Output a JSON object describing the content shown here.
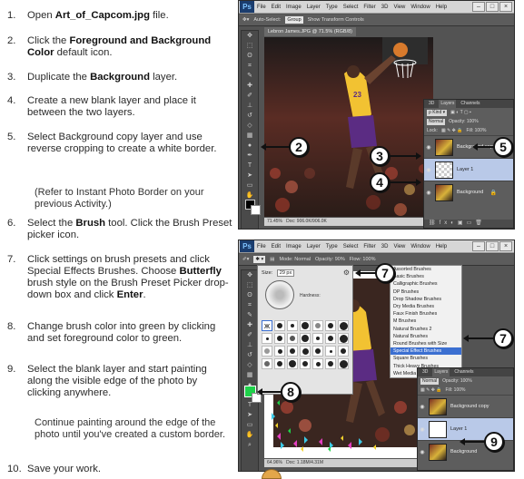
{
  "steps": [
    {
      "num": "1.",
      "parts": [
        {
          "t": "Open "
        },
        {
          "t": "Art_of_Capcom.jpg",
          "b": true
        },
        {
          "t": " file."
        }
      ]
    },
    {
      "num": "2.",
      "parts": [
        {
          "t": "Click the "
        },
        {
          "t": "Foreground and Background Color",
          "b": true
        },
        {
          "t": " default icon."
        }
      ]
    },
    {
      "num": "3.",
      "parts": [
        {
          "t": "Duplicate the "
        },
        {
          "t": "Background",
          "b": true
        },
        {
          "t": " layer."
        }
      ]
    },
    {
      "num": "4.",
      "parts": [
        {
          "t": "Create a new blank layer and place it between the two layers."
        }
      ]
    },
    {
      "num": "5.",
      "parts": [
        {
          "t": "Select Background copy layer and use reverse cropping to create a white border."
        }
      ]
    },
    {
      "num": "6.",
      "parts": [
        {
          "t": "Select the "
        },
        {
          "t": "Brush",
          "b": true
        },
        {
          "t": " tool. Click the Brush Preset picker icon."
        }
      ]
    },
    {
      "num": "7.",
      "parts": [
        {
          "t": "Click settings on brush presets and click Special Effects Brushes. Choose "
        },
        {
          "t": "Butterfly",
          "b": true
        },
        {
          "t": " brush style on the Brush Preset Picker drop-down box and click "
        },
        {
          "t": "Enter",
          "b": true
        },
        {
          "t": "."
        }
      ]
    },
    {
      "num": "8.",
      "parts": [
        {
          "t": "Change brush color into green by clicking and set foreground color to green."
        }
      ]
    },
    {
      "num": "9.",
      "parts": [
        {
          "t": "Select the blank layer and start painting along the visible edge of the photo by clicking anywhere."
        }
      ]
    },
    {
      "num": "10.",
      "parts": [
        {
          "t": "Save your work."
        }
      ]
    }
  ],
  "notes": {
    "after5": "(Refer to Instant Photo Border on your previous Activity.)",
    "after9": "Continue painting around the edge of the photo until you've created a custom border."
  },
  "ps_top": {
    "logo": "Ps",
    "menus": [
      "File",
      "Edit",
      "Image",
      "Layer",
      "Type",
      "Select",
      "Filter",
      "3D",
      "View",
      "Window",
      "Help"
    ],
    "options": [
      "Auto-Select:",
      "Group",
      "Show Transform Controls"
    ],
    "doc_tab": "Lebron James.JPG @ 71.5% (RGB/8)",
    "zoom": "71.45%",
    "doc_size": "Doc: 906.0K/906.0K",
    "timeline": "Timeline",
    "panel_tabs": [
      "3D",
      "Layers",
      "Channels"
    ],
    "blend": "Normal",
    "opacity": "Opacity: 100%",
    "fill": "Fill: 100%",
    "lock": "Lock:",
    "layers": [
      "Background copy",
      "Layer 1",
      "Background"
    ]
  },
  "ps_bottom": {
    "logo": "Ps",
    "menus": [
      "File",
      "Edit",
      "Image",
      "Layer",
      "Type",
      "Select",
      "Filter",
      "3D",
      "View",
      "Window",
      "Help"
    ],
    "mode": "Mode: Normal",
    "opacity": "Opacity: 90%",
    "flow": "Flow: 100%",
    "size_label": "Size:",
    "size_value": "29 px",
    "hardness": "Hardness:",
    "zoom": "64.96%",
    "doc_size": "Doc: 1.18M/4.31M",
    "timeline": "Timeline",
    "brush_sets": [
      "Assorted Brushes",
      "Basic Brushes",
      "Calligraphic Brushes",
      "DP Brushes",
      "Drop Shadow Brushes",
      "Dry Media Brushes",
      "Faux Finish Brushes",
      "M Brushes",
      "Natural Brushes 2",
      "Natural Brushes",
      "Round Brushes with Size",
      "Special Effect Brushes",
      "Square Brushes",
      "Thick Heavy Brushes",
      "Wet Media Brushes"
    ],
    "highlighted_set": "Special Effect Brushes",
    "panel_tabs": [
      "3D",
      "Layers",
      "Channels"
    ],
    "blend": "Normal",
    "opacity_layer": "Opacity: 100%",
    "fill": "Fill: 100%",
    "layers": [
      "Background copy",
      "Layer 1",
      "Background"
    ]
  },
  "callouts": [
    "2",
    "3",
    "4",
    "5",
    "7",
    "7",
    "8",
    "9"
  ],
  "colors": {
    "green": "#1fd14a",
    "highlight": "#3b6fd1",
    "selected_layer": "#b9c9e8"
  }
}
